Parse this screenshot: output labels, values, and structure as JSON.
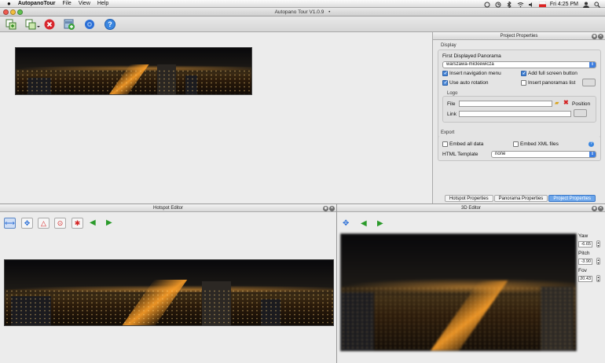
{
  "menubar": {
    "apple": "",
    "app_name": "AutopanoTour",
    "items": [
      "File",
      "View",
      "Help"
    ],
    "clock": "Fri 4:25 PM"
  },
  "window": {
    "title": "Autopano Tour V1.0.9"
  },
  "project_properties": {
    "title": "Project Properties",
    "display": {
      "section_label": "Display",
      "first_panorama_label": "First Displayed Panorama",
      "first_panorama_value": "warszawa-mickiewicza",
      "insert_navigation_menu": {
        "label": "Insert navigation menu",
        "checked": true
      },
      "add_full_screen_button": {
        "label": "Add full screen button",
        "checked": true
      },
      "use_auto_rotation": {
        "label": "Use auto rotation",
        "checked": true
      },
      "insert_panoramas_list": {
        "label": "Insert panoramas list",
        "checked": false
      }
    },
    "logo": {
      "section_label": "Logo",
      "file_label": "File",
      "file_value": "",
      "position_label": "Position",
      "link_label": "Link",
      "link_value": ""
    },
    "export": {
      "section_label": "Export",
      "embed_all_data": {
        "label": "Embed all data",
        "checked": false
      },
      "embed_xml_files": {
        "label": "Embed XML files",
        "checked": false
      },
      "html_template_label": "HTML Template",
      "html_template_value": "none"
    },
    "tabs": [
      {
        "label": "Hotspot Properties",
        "active": false
      },
      {
        "label": "Panorama Properties",
        "active": false
      },
      {
        "label": "Project Properties",
        "active": true
      }
    ]
  },
  "hotspot_editor": {
    "title": "Hotspot Editor"
  },
  "editor_3d": {
    "title": "3D Editor",
    "yaw_label": "Yaw",
    "yaw_value": "-6.65",
    "pitch_label": "Pitch",
    "pitch_value": "-3.90",
    "fov_label": "Fov",
    "fov_value": "20.43"
  },
  "colors": {
    "accent": "#3b7de0",
    "active_tab": "#6da6ea",
    "arrow_green": "#2a9a2a"
  }
}
